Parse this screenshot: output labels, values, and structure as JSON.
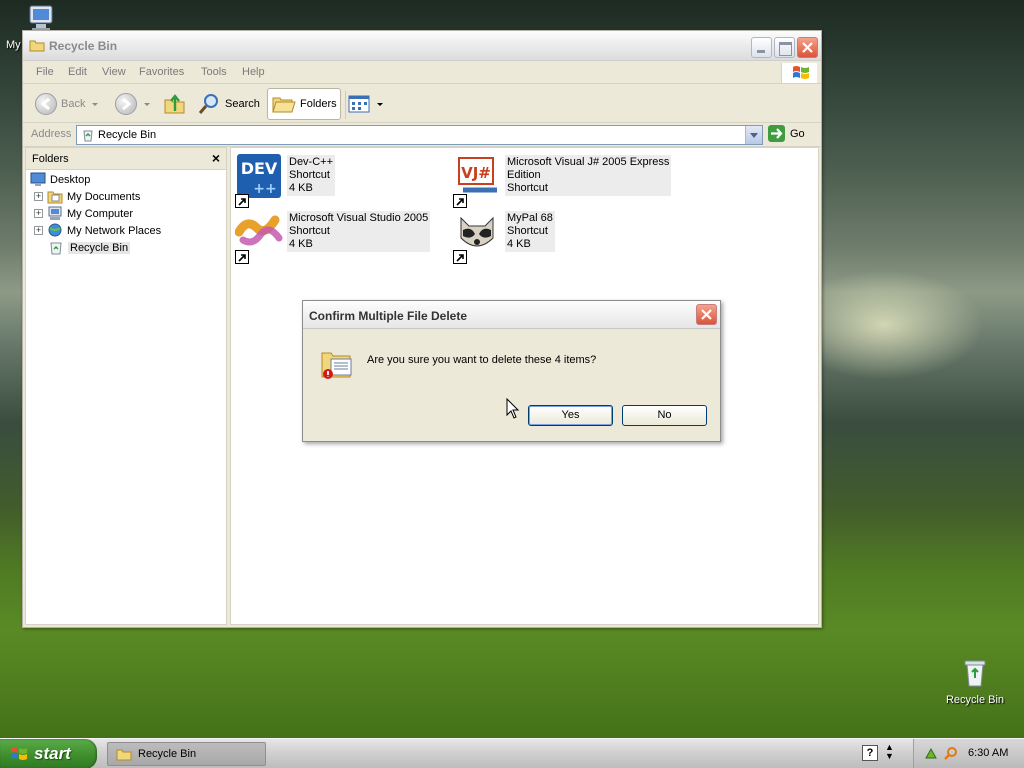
{
  "desktop": {
    "my_computer_label": "My",
    "recycle_bin_label": "Recycle Bin"
  },
  "window": {
    "title": "Recycle Bin",
    "menu": [
      "File",
      "Edit",
      "View",
      "Favorites",
      "Tools",
      "Help"
    ],
    "toolbar": {
      "back_label": "Back",
      "search_label": "Search",
      "folders_label": "Folders"
    },
    "address": {
      "label": "Address",
      "value": "Recycle Bin",
      "go_label": "Go"
    },
    "folders_pane": {
      "title": "Folders",
      "close_glyph": "×",
      "tree": [
        {
          "label": "Desktop",
          "expander": ""
        },
        {
          "label": "My Documents",
          "expander": "+"
        },
        {
          "label": "My Computer",
          "expander": "+"
        },
        {
          "label": "My Network Places",
          "expander": "+"
        },
        {
          "label": "Recycle Bin",
          "expander": ""
        }
      ]
    },
    "files": [
      {
        "name": "Dev-C++",
        "type": "Shortcut",
        "size": "4 KB",
        "icon": "devcpp-icon"
      },
      {
        "name": "Microsoft Visual J# 2005 Express",
        "name2": "Edition",
        "type": "Shortcut",
        "icon": "vjsharp-icon"
      },
      {
        "name": "Microsoft Visual Studio 2005",
        "type": "Shortcut",
        "size": "4 KB",
        "icon": "visual-studio-icon"
      },
      {
        "name": "MyPal 68",
        "type": "Shortcut",
        "size": "4 KB",
        "icon": "mypal-icon"
      }
    ]
  },
  "dialog": {
    "title": "Confirm Multiple File Delete",
    "message": "Are you sure you want to delete these 4 items?",
    "yes_label": "Yes",
    "no_label": "No"
  },
  "taskbar": {
    "start_label": "start",
    "task_label": "Recycle Bin",
    "help_glyph": "?",
    "clock": "6:30 AM"
  },
  "colors": {
    "dialog_default_button_ring": "#7ba0e6",
    "close_button": "#d9553b",
    "start_button": "#3c8c2c"
  }
}
